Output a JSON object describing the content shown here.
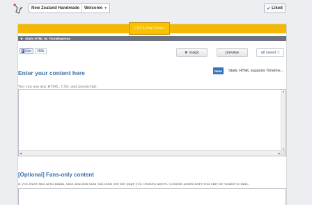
{
  "header": {
    "page_name": "New Zealand Handmade",
    "menu_label": "Welcome",
    "liked_label": "Liked",
    "liked_check": "✓"
  },
  "banner": {
    "help_label": "FAQ & Help Center",
    "app_title": "Static HTML by Thunderpenny"
  },
  "toolbar": {
    "like_label": "Like",
    "like_count": "156k",
    "magic_label": "magic",
    "preview_label": "preview",
    "saved_label": "all saved :)"
  },
  "section1": {
    "heading": "Enter your content here",
    "new_badge": "New!",
    "new_text": "Static HTML supports Timeline...",
    "hint": "You can use any HTML, CSS, and JavaScript."
  },
  "section2": {
    "heading": "[Optional] Fans-only content",
    "hint": "If you leave this area blank, fans and non-fans will both see the page you created above. Content added here will only be visible to fans."
  },
  "colors": {
    "accent_blue": "#3a6ea5",
    "banner_yellow": "#f5b800",
    "strip_gray": "#6d7180"
  }
}
